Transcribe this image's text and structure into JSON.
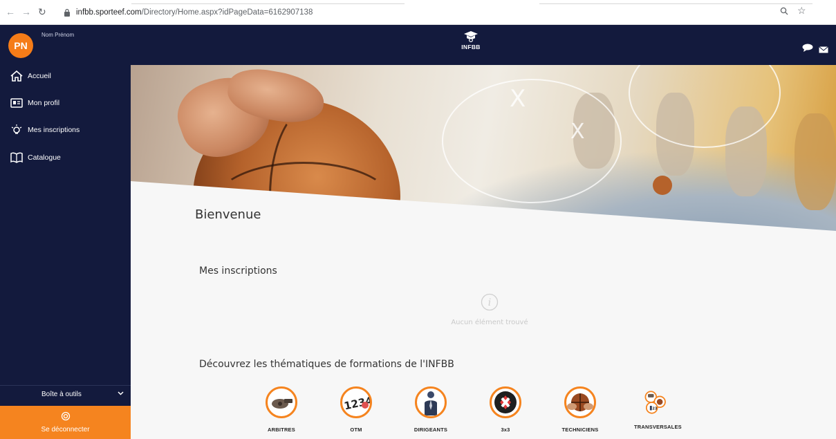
{
  "browser": {
    "url_host": "infbb.sporteef.com",
    "url_path": "/Directory/Home.aspx?idPageData=6162907138"
  },
  "sidebar": {
    "user_initials": "PN",
    "user_name": "Nom Prénom",
    "items": [
      {
        "label": "Accueil",
        "icon": "home-icon"
      },
      {
        "label": "Mon profil",
        "icon": "id-card-icon"
      },
      {
        "label": "Mes inscriptions",
        "icon": "lightbulb-icon"
      },
      {
        "label": "Catalogue",
        "icon": "book-icon"
      }
    ],
    "toolbox_label": "Boîte à outils",
    "logout_label": "Se déconnecter"
  },
  "header": {
    "logo_text": "INFBB"
  },
  "main": {
    "welcome": "Bienvenue",
    "registrations_title": "Mes inscriptions",
    "empty_text": "Aucun élément trouvé",
    "themes_title": "Découvrez les thématiques de formations de l'INFBB",
    "themes": [
      {
        "label": "ARBITRES",
        "icon": "whistle-icon"
      },
      {
        "label": "OTM",
        "icon": "scoreboard-icon"
      },
      {
        "label": "DIRIGEANTS",
        "icon": "executive-icon"
      },
      {
        "label": "3x3",
        "icon": "three-by-three-icon"
      },
      {
        "label": "TECHNICIENS",
        "icon": "basketball-hands-icon"
      },
      {
        "label": "TRANSVERSALES",
        "icon": "cross-themes-icon"
      }
    ]
  },
  "colors": {
    "navy": "#131a3d",
    "accent": "#f5841f"
  }
}
